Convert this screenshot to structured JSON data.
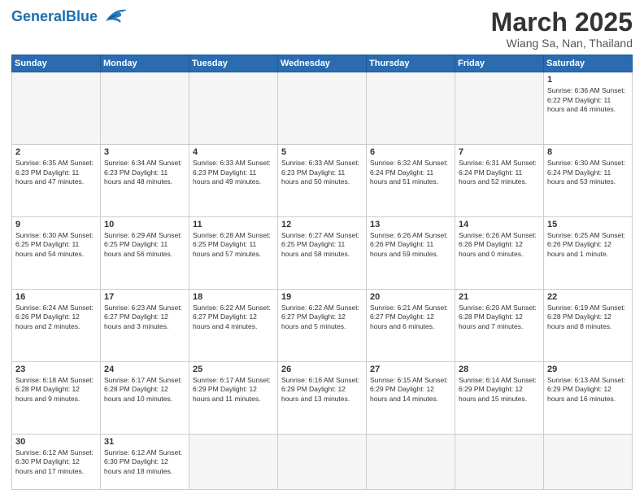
{
  "header": {
    "logo_general": "General",
    "logo_blue": "Blue",
    "month": "March 2025",
    "location": "Wiang Sa, Nan, Thailand"
  },
  "days_of_week": [
    "Sunday",
    "Monday",
    "Tuesday",
    "Wednesday",
    "Thursday",
    "Friday",
    "Saturday"
  ],
  "cells": [
    {
      "day": "",
      "empty": true,
      "text": ""
    },
    {
      "day": "",
      "empty": true,
      "text": ""
    },
    {
      "day": "",
      "empty": true,
      "text": ""
    },
    {
      "day": "",
      "empty": true,
      "text": ""
    },
    {
      "day": "",
      "empty": true,
      "text": ""
    },
    {
      "day": "",
      "empty": true,
      "text": ""
    },
    {
      "day": "1",
      "empty": false,
      "text": "Sunrise: 6:36 AM\nSunset: 6:22 PM\nDaylight: 11 hours\nand 46 minutes."
    },
    {
      "day": "2",
      "empty": false,
      "text": "Sunrise: 6:35 AM\nSunset: 6:23 PM\nDaylight: 11 hours\nand 47 minutes."
    },
    {
      "day": "3",
      "empty": false,
      "text": "Sunrise: 6:34 AM\nSunset: 6:23 PM\nDaylight: 11 hours\nand 48 minutes."
    },
    {
      "day": "4",
      "empty": false,
      "text": "Sunrise: 6:33 AM\nSunset: 6:23 PM\nDaylight: 11 hours\nand 49 minutes."
    },
    {
      "day": "5",
      "empty": false,
      "text": "Sunrise: 6:33 AM\nSunset: 6:23 PM\nDaylight: 11 hours\nand 50 minutes."
    },
    {
      "day": "6",
      "empty": false,
      "text": "Sunrise: 6:32 AM\nSunset: 6:24 PM\nDaylight: 11 hours\nand 51 minutes."
    },
    {
      "day": "7",
      "empty": false,
      "text": "Sunrise: 6:31 AM\nSunset: 6:24 PM\nDaylight: 11 hours\nand 52 minutes."
    },
    {
      "day": "8",
      "empty": false,
      "text": "Sunrise: 6:30 AM\nSunset: 6:24 PM\nDaylight: 11 hours\nand 53 minutes."
    },
    {
      "day": "9",
      "empty": false,
      "text": "Sunrise: 6:30 AM\nSunset: 6:25 PM\nDaylight: 11 hours\nand 54 minutes."
    },
    {
      "day": "10",
      "empty": false,
      "text": "Sunrise: 6:29 AM\nSunset: 6:25 PM\nDaylight: 11 hours\nand 56 minutes."
    },
    {
      "day": "11",
      "empty": false,
      "text": "Sunrise: 6:28 AM\nSunset: 6:25 PM\nDaylight: 11 hours\nand 57 minutes."
    },
    {
      "day": "12",
      "empty": false,
      "text": "Sunrise: 6:27 AM\nSunset: 6:25 PM\nDaylight: 11 hours\nand 58 minutes."
    },
    {
      "day": "13",
      "empty": false,
      "text": "Sunrise: 6:26 AM\nSunset: 6:26 PM\nDaylight: 11 hours\nand 59 minutes."
    },
    {
      "day": "14",
      "empty": false,
      "text": "Sunrise: 6:26 AM\nSunset: 6:26 PM\nDaylight: 12 hours\nand 0 minutes."
    },
    {
      "day": "15",
      "empty": false,
      "text": "Sunrise: 6:25 AM\nSunset: 6:26 PM\nDaylight: 12 hours\nand 1 minute."
    },
    {
      "day": "16",
      "empty": false,
      "text": "Sunrise: 6:24 AM\nSunset: 6:26 PM\nDaylight: 12 hours\nand 2 minutes."
    },
    {
      "day": "17",
      "empty": false,
      "text": "Sunrise: 6:23 AM\nSunset: 6:27 PM\nDaylight: 12 hours\nand 3 minutes."
    },
    {
      "day": "18",
      "empty": false,
      "text": "Sunrise: 6:22 AM\nSunset: 6:27 PM\nDaylight: 12 hours\nand 4 minutes."
    },
    {
      "day": "19",
      "empty": false,
      "text": "Sunrise: 6:22 AM\nSunset: 6:27 PM\nDaylight: 12 hours\nand 5 minutes."
    },
    {
      "day": "20",
      "empty": false,
      "text": "Sunrise: 6:21 AM\nSunset: 6:27 PM\nDaylight: 12 hours\nand 6 minutes."
    },
    {
      "day": "21",
      "empty": false,
      "text": "Sunrise: 6:20 AM\nSunset: 6:28 PM\nDaylight: 12 hours\nand 7 minutes."
    },
    {
      "day": "22",
      "empty": false,
      "text": "Sunrise: 6:19 AM\nSunset: 6:28 PM\nDaylight: 12 hours\nand 8 minutes."
    },
    {
      "day": "23",
      "empty": false,
      "text": "Sunrise: 6:18 AM\nSunset: 6:28 PM\nDaylight: 12 hours\nand 9 minutes."
    },
    {
      "day": "24",
      "empty": false,
      "text": "Sunrise: 6:17 AM\nSunset: 6:28 PM\nDaylight: 12 hours\nand 10 minutes."
    },
    {
      "day": "25",
      "empty": false,
      "text": "Sunrise: 6:17 AM\nSunset: 6:29 PM\nDaylight: 12 hours\nand 11 minutes."
    },
    {
      "day": "26",
      "empty": false,
      "text": "Sunrise: 6:16 AM\nSunset: 6:29 PM\nDaylight: 12 hours\nand 13 minutes."
    },
    {
      "day": "27",
      "empty": false,
      "text": "Sunrise: 6:15 AM\nSunset: 6:29 PM\nDaylight: 12 hours\nand 14 minutes."
    },
    {
      "day": "28",
      "empty": false,
      "text": "Sunrise: 6:14 AM\nSunset: 6:29 PM\nDaylight: 12 hours\nand 15 minutes."
    },
    {
      "day": "29",
      "empty": false,
      "text": "Sunrise: 6:13 AM\nSunset: 6:29 PM\nDaylight: 12 hours\nand 16 minutes."
    },
    {
      "day": "30",
      "empty": false,
      "text": "Sunrise: 6:12 AM\nSunset: 6:30 PM\nDaylight: 12 hours\nand 17 minutes."
    },
    {
      "day": "31",
      "empty": false,
      "text": "Sunrise: 6:12 AM\nSunset: 6:30 PM\nDaylight: 12 hours\nand 18 minutes."
    },
    {
      "day": "",
      "empty": true,
      "text": ""
    },
    {
      "day": "",
      "empty": true,
      "text": ""
    },
    {
      "day": "",
      "empty": true,
      "text": ""
    },
    {
      "day": "",
      "empty": true,
      "text": ""
    },
    {
      "day": "",
      "empty": true,
      "text": ""
    }
  ]
}
